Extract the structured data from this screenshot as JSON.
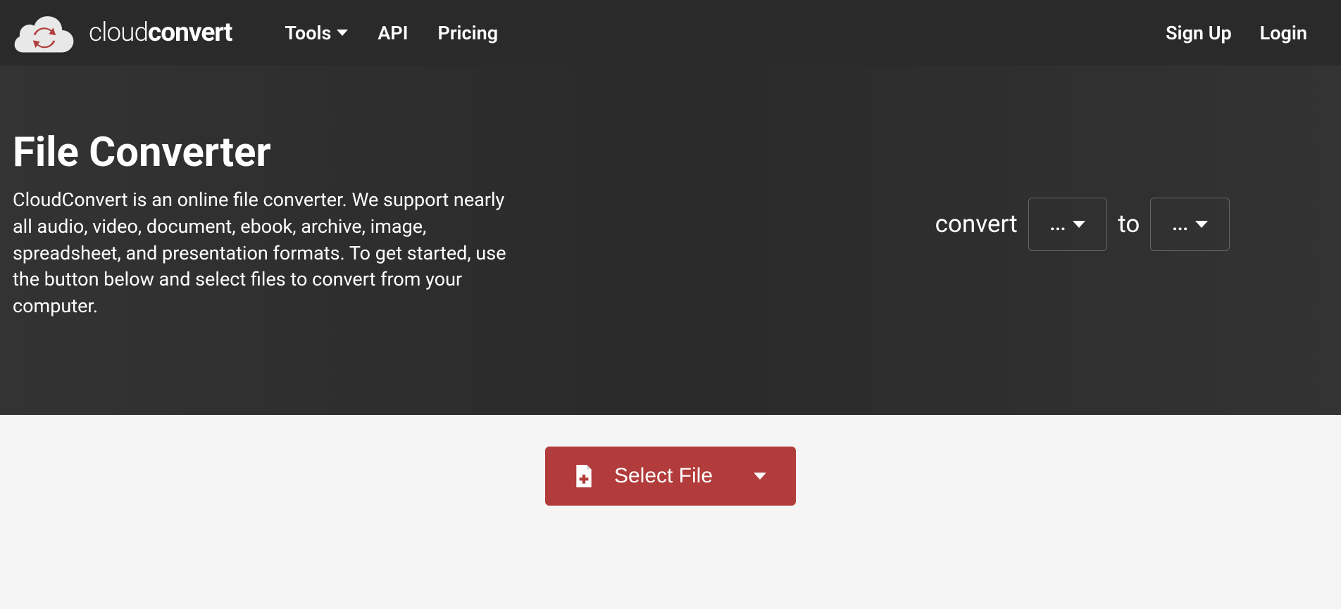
{
  "logo": {
    "light": "cloud",
    "bold": "convert"
  },
  "nav": {
    "tools": "Tools",
    "api": "API",
    "pricing": "Pricing"
  },
  "auth": {
    "signup": "Sign Up",
    "login": "Login"
  },
  "hero": {
    "title": "File Converter",
    "description": "CloudConvert is an online file converter. We support nearly all audio, video, document, ebook, archive, image, spreadsheet, and presentation formats. To get started, use the button below and select files to convert from your computer."
  },
  "convert": {
    "label_convert": "convert",
    "label_to": "to",
    "from_placeholder": "...",
    "to_placeholder": "..."
  },
  "select_file": {
    "label": "Select File"
  }
}
